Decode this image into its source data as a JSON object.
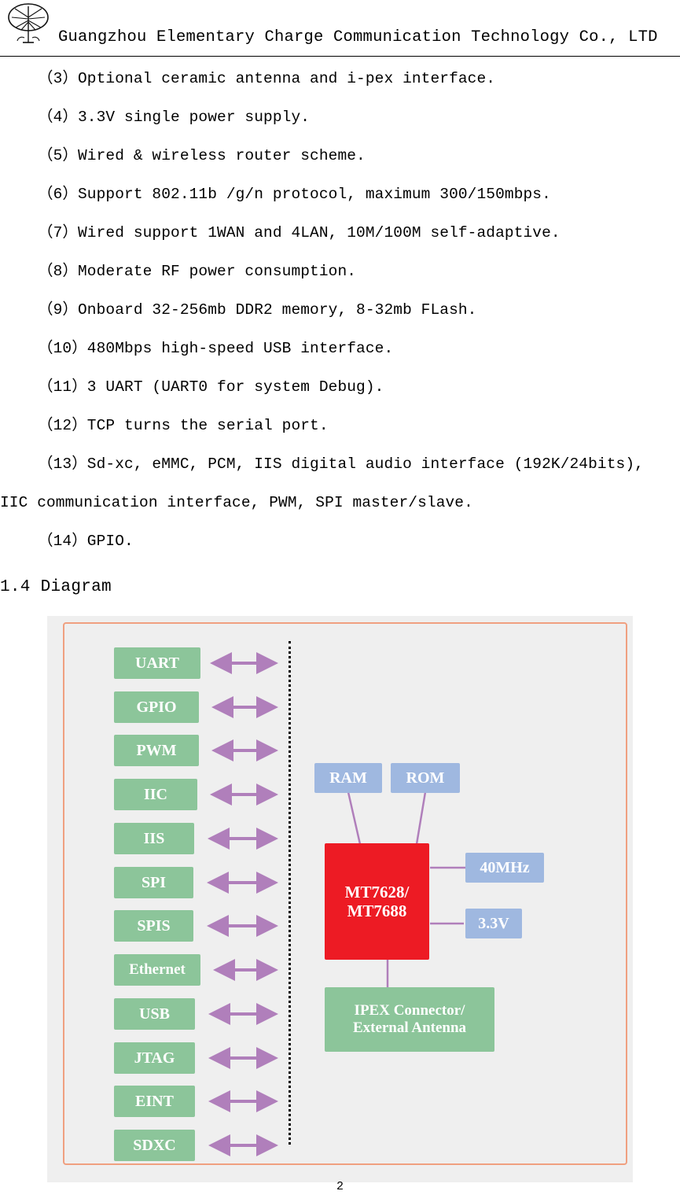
{
  "header": {
    "title": "Guangzhou Elementary Charge Communication Technology Co., LTD",
    "logo_icon": "tree-logo-icon"
  },
  "body": {
    "items": [
      "（3）Optional ceramic antenna and i-pex interface.",
      "（4）3.3V single power supply.",
      "（5）Wired & wireless router scheme.",
      "（6）Support 802.11b /g/n protocol, maximum 300/150mbps.",
      "（7）Wired support 1WAN and 4LAN, 10M/100M self-adaptive.",
      "（8）Moderate RF power consumption.",
      "（9）Onboard 32-256mb DDR2 memory, 8-32mb FLash.",
      "（10）480Mbps high-speed USB interface.",
      "（11）3 UART (UART0 for system Debug).",
      "（12）TCP turns the serial port.",
      "（13）Sd-xc, eMMC, PCM, IIS digital audio interface (192K/24bits),"
    ],
    "continuation": "IIC communication interface, PWM, SPI master/slave.",
    "last_item": "（14）GPIO.",
    "section_title": "1.4 Diagram"
  },
  "diagram": {
    "left_blocks": [
      "UART",
      "GPIO",
      "PWM",
      "IIC",
      "IIS",
      "SPI",
      "SPIS",
      "Ethernet",
      "USB",
      "JTAG",
      "EINT",
      "SDXC"
    ],
    "ram": "RAM",
    "rom": "ROM",
    "chip_line1": "MT7628/",
    "chip_line2": "MT7688",
    "clock": "40MHz",
    "voltage": "3.3V",
    "antenna_line1": "IPEX Connector/",
    "antenna_line2": "External Antenna",
    "colors": {
      "green": "#8cc59a",
      "blue": "#9fb8e0",
      "red": "#ed1b24",
      "frame": "#f0a080",
      "arrow": "#b07fbb",
      "background": "#efefef"
    }
  },
  "footer": {
    "page_number": "2"
  }
}
